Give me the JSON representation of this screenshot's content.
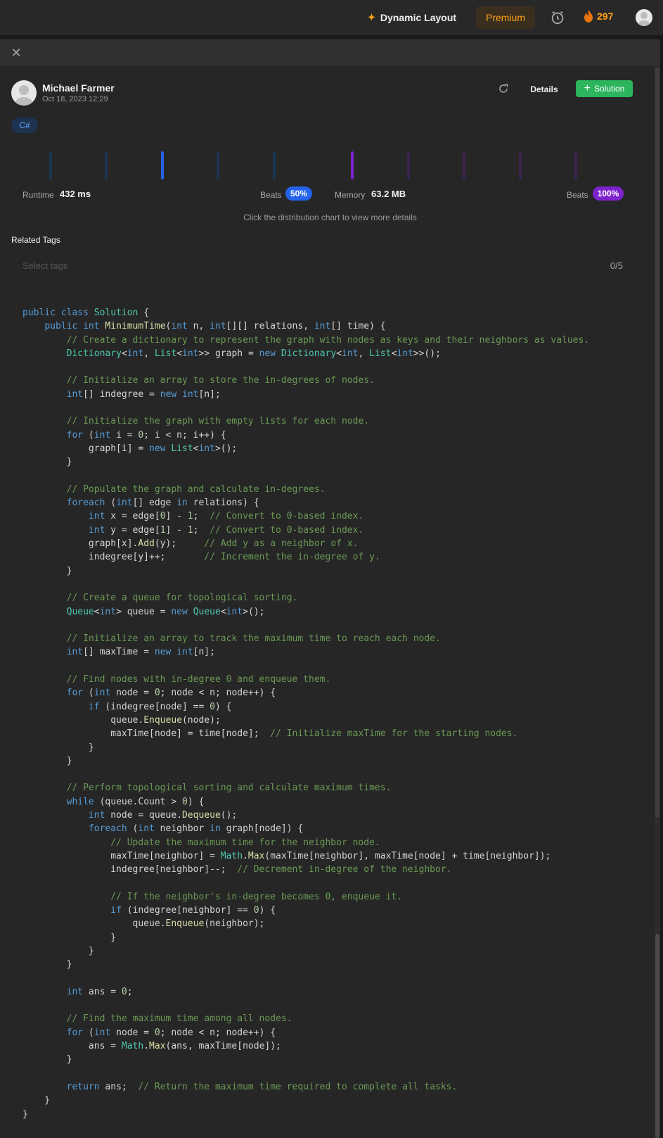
{
  "topbar": {
    "dynamic_layout_label": "Dynamic Layout",
    "premium_label": "Premium",
    "streak_count": "297"
  },
  "panel": {
    "close_icon": "close-icon"
  },
  "submission": {
    "author": "Michael Farmer",
    "date": "Oct 18, 2023 12:29",
    "details_label": "Details",
    "solution_label": "Solution",
    "language": "C#"
  },
  "stats": {
    "runtime_label": "Runtime",
    "runtime_value": "432 ms",
    "runtime_beats_label": "Beats",
    "runtime_beats": "50%",
    "memory_label": "Memory",
    "memory_value": "63.2 MB",
    "memory_beats_label": "Beats",
    "memory_beats": "100%",
    "hint": "Click the distribution chart to view more details"
  },
  "tags": {
    "label": "Related Tags",
    "placeholder": "Select tags",
    "count": "0/5"
  },
  "colors": {
    "runtime_accent": "#2563eb",
    "memory_accent": "#7e22ce",
    "solution_green": "#2db55d",
    "premium_orange": "#ffa116"
  },
  "code": {
    "language": "csharp",
    "lines": [
      "public class Solution {",
      "    public int MinimumTime(int n, int[][] relations, int[] time) {",
      "        // Create a dictionary to represent the graph with nodes as keys and their neighbors as values.",
      "        Dictionary<int, List<int>> graph = new Dictionary<int, List<int>>();",
      "",
      "        // Initialize an array to store the in-degrees of nodes.",
      "        int[] indegree = new int[n];",
      "",
      "        // Initialize the graph with empty lists for each node.",
      "        for (int i = 0; i < n; i++) {",
      "            graph[i] = new List<int>();",
      "        }",
      "",
      "        // Populate the graph and calculate in-degrees.",
      "        foreach (int[] edge in relations) {",
      "            int x = edge[0] - 1;  // Convert to 0-based index.",
      "            int y = edge[1] - 1;  // Convert to 0-based index.",
      "            graph[x].Add(y);     // Add y as a neighbor of x.",
      "            indegree[y]++;       // Increment the in-degree of y.",
      "        }",
      "",
      "        // Create a queue for topological sorting.",
      "        Queue<int> queue = new Queue<int>();",
      "",
      "        // Initialize an array to track the maximum time to reach each node.",
      "        int[] maxTime = new int[n];",
      "",
      "        // Find nodes with in-degree 0 and enqueue them.",
      "        for (int node = 0; node < n; node++) {",
      "            if (indegree[node] == 0) {",
      "                queue.Enqueue(node);",
      "                maxTime[node] = time[node];  // Initialize maxTime for the starting nodes.",
      "            }",
      "        }",
      "",
      "        // Perform topological sorting and calculate maximum times.",
      "        while (queue.Count > 0) {",
      "            int node = queue.Dequeue();",
      "            foreach (int neighbor in graph[node]) {",
      "                // Update the maximum time for the neighbor node.",
      "                maxTime[neighbor] = Math.Max(maxTime[neighbor], maxTime[node] + time[neighbor]);",
      "                indegree[neighbor]--;  // Decrement in-degree of the neighbor.",
      "",
      "                // If the neighbor's in-degree becomes 0, enqueue it.",
      "                if (indegree[neighbor] == 0) {",
      "                    queue.Enqueue(neighbor);",
      "                }",
      "            }",
      "        }",
      "",
      "        int ans = 0;",
      "",
      "        // Find the maximum time among all nodes.",
      "        for (int node = 0; node < n; node++) {",
      "            ans = Math.Max(ans, maxTime[node]);",
      "        }",
      "",
      "        return ans;  // Return the maximum time required to complete all tasks.",
      "    }",
      "}"
    ]
  }
}
